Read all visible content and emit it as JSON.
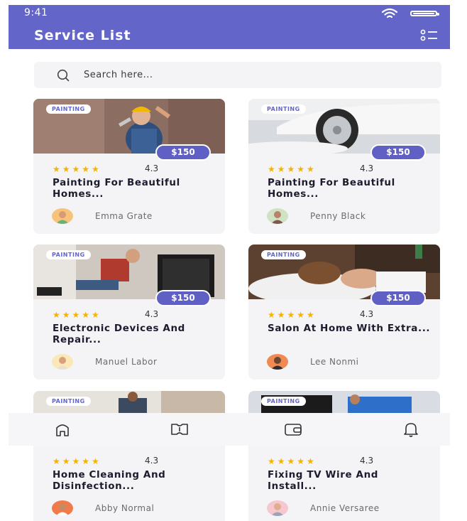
{
  "status_bar": {
    "time": "9:41"
  },
  "header": {
    "title": "Service List",
    "filter_icon": "filter-list-icon"
  },
  "search": {
    "placeholder": "Search here...",
    "value": ""
  },
  "colors": {
    "accent": "#6366c8",
    "price": "#5f5fc4",
    "star": "#f5b301",
    "card_bg": "#f4f4f7"
  },
  "cards": [
    {
      "category": "PAINTING",
      "price": "$150",
      "stars": "★★★★★",
      "rating": "4.3",
      "title": "Painting For Beautiful Homes...",
      "provider": "Emma Grate"
    },
    {
      "category": "PAINTING",
      "price": "$150",
      "stars": "★★★★★",
      "rating": "4.3",
      "title": "Painting For Beautiful Homes...",
      "provider": "Penny Black"
    },
    {
      "category": "PAINTING",
      "price": "$150",
      "stars": "★★★★★",
      "rating": "4.3",
      "title": "Electronic Devices And Repair...",
      "provider": "Manuel Labor"
    },
    {
      "category": "PAINTING",
      "price": "$150",
      "stars": "★★★★★",
      "rating": "4.3",
      "title": "Salon At Home With Extra...",
      "provider": "Lee Nonmi"
    },
    {
      "category": "PAINTING",
      "price": "",
      "stars": "★★★★★",
      "rating": "4.3",
      "title": "Home Cleaning And Disinfection...",
      "provider": "Abby Normal"
    },
    {
      "category": "PAINTING",
      "price": "",
      "stars": "★★★★★",
      "rating": "4.3",
      "title": "Fixing TV Wire And Install...",
      "provider": "Annie Versaree"
    }
  ],
  "bottom_nav": [
    {
      "icon": "home-icon"
    },
    {
      "icon": "services-icon"
    },
    {
      "icon": "wallet-icon"
    },
    {
      "icon": "bell-icon"
    }
  ]
}
